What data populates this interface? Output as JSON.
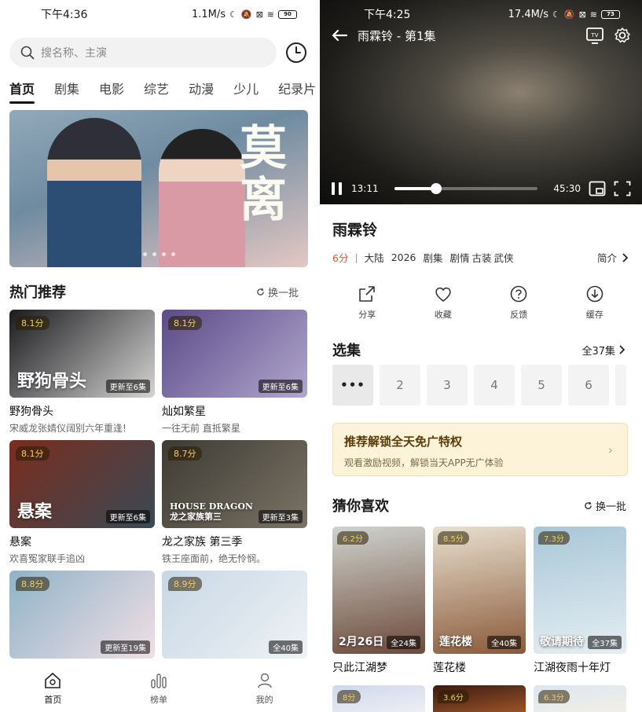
{
  "left": {
    "status": {
      "time": "下午4:36",
      "speed": "1.1M/s",
      "battery": "90"
    },
    "search": {
      "placeholder": "搜名称、主演"
    },
    "tabs": [
      "首页",
      "剧集",
      "电影",
      "综艺",
      "动漫",
      "少儿",
      "纪录片"
    ],
    "banner": {
      "title_chars": [
        "莫",
        "离"
      ]
    },
    "hot": {
      "title": "热门推荐",
      "refresh": "换一批",
      "items": [
        {
          "score": "8.1分",
          "update": "更新至6集",
          "name": "野狗骨头",
          "desc": "宋威龙张婧仪阔别六年重逢!",
          "overlay": "野狗骨头",
          "colors": [
            "#1b1b1f",
            "#d4d4d2"
          ]
        },
        {
          "score": "8.1分",
          "update": "更新至6集",
          "name": "灿如繁星",
          "desc": "一往无前 直抵繁星",
          "colors": [
            "#5b4a88",
            "#b1a7cd"
          ]
        },
        {
          "score": "8.1分",
          "update": "更新至6集",
          "name": "悬案",
          "desc": "欢喜冤家联手追凶",
          "overlay": "悬案",
          "colors": [
            "#7a2c1d",
            "#3a4a55"
          ]
        },
        {
          "score": "8.7分",
          "update": "更新至3集",
          "name": "龙之家族 第三季",
          "desc": "铁王座面前，绝无怜悯。",
          "overlay": "HOUSE DRAGON\n龙之家族第三",
          "colors": [
            "#3e3a33",
            "#7a7466"
          ]
        },
        {
          "score": "8.8分",
          "update": "更新至19集",
          "name": "",
          "desc": "",
          "colors": [
            "#8fb3c9",
            "#f1dfe4"
          ]
        },
        {
          "score": "8.9分",
          "update": "全40集",
          "name": "",
          "desc": "",
          "colors": [
            "#c8d7e5",
            "#eef2f5"
          ]
        }
      ]
    },
    "nav": [
      {
        "label": "首页",
        "icon": "home-icon",
        "active": true
      },
      {
        "label": "榜单",
        "icon": "ranking-icon",
        "active": false
      },
      {
        "label": "我的",
        "icon": "profile-icon",
        "active": false
      }
    ]
  },
  "right": {
    "status": {
      "time": "下午4:25",
      "speed": "17.4M/s",
      "battery": "73"
    },
    "player": {
      "title": "雨霖铃 - 第1集",
      "current_time": "13:11",
      "duration": "45:30",
      "progress": 0.29
    },
    "show": {
      "title": "雨霖铃",
      "score": "6分",
      "tags": [
        "大陆",
        "2026",
        "剧集",
        "剧情",
        "古装",
        "武侠"
      ],
      "intro": "简介"
    },
    "actions": [
      {
        "label": "分享",
        "icon": "share-icon"
      },
      {
        "label": "收藏",
        "icon": "heart-icon"
      },
      {
        "label": "反馈",
        "icon": "question-icon"
      },
      {
        "label": "缓存",
        "icon": "download-icon"
      }
    ],
    "episodes": {
      "title": "选集",
      "total": "全37集",
      "items": [
        "...",
        "2",
        "3",
        "4",
        "5",
        "6"
      ]
    },
    "promo": {
      "title": "推荐解锁全天免广特权",
      "desc": "观看激励视频，解锁当天APP无广体验"
    },
    "guess": {
      "title": "猜你喜欢",
      "refresh": "换一批",
      "items": [
        {
          "score": "6.2分",
          "update": "全24集",
          "name": "只此江湖梦",
          "overlay": "2月26日",
          "colors": [
            "#cfd3cf",
            "#6d4a3a"
          ]
        },
        {
          "score": "8.5分",
          "update": "全40集",
          "name": "莲花楼",
          "overlay": "莲花楼",
          "colors": [
            "#e8e0d0",
            "#8a5a3a"
          ]
        },
        {
          "score": "7.3分",
          "update": "全37集",
          "name": "江湖夜雨十年灯",
          "overlay": "敬请期待",
          "colors": [
            "#a9c7d8",
            "#e5eef2"
          ]
        }
      ],
      "more": [
        {
          "score": "8分",
          "colors": [
            "#cfd8ea",
            "#f1f1f6"
          ]
        },
        {
          "score": "3.6分",
          "colors": [
            "#3a1a12",
            "#a55a2a"
          ]
        },
        {
          "score": "6.3分",
          "colors": [
            "#dde6f0",
            "#f4f0e6"
          ]
        }
      ]
    }
  }
}
